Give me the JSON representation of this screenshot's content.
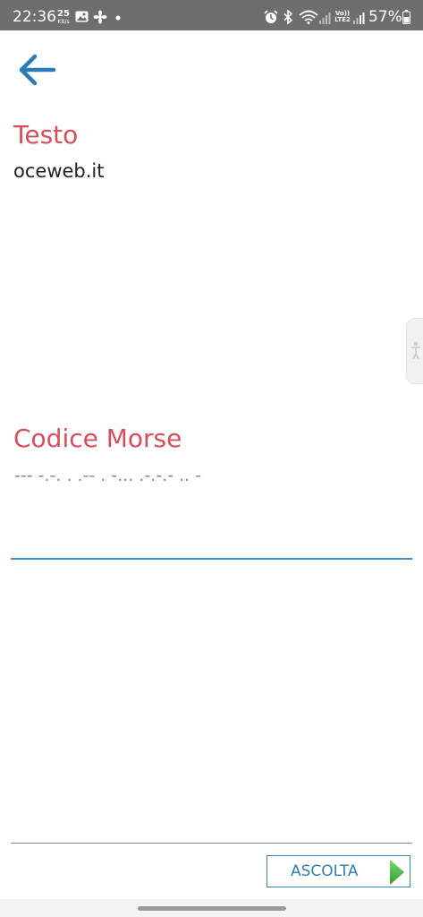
{
  "status_bar": {
    "time": "22:36",
    "net_speed_value": "25",
    "net_speed_unit": "KB/s",
    "battery_text": "57%",
    "volte_label": "Vo)) LTE2",
    "icons": [
      "gallery-icon",
      "fan-icon",
      "dot-icon",
      "alarm-icon",
      "bluetooth-icon",
      "wifi-icon",
      "signal-icon",
      "volte-icon",
      "signal-icon",
      "battery-icon"
    ]
  },
  "header": {
    "back_icon": "arrow-left-icon"
  },
  "text_section": {
    "label": "Testo",
    "value": "oceweb.it"
  },
  "morse_section": {
    "label": "Codice Morse",
    "value": "--- -.-. . .-- . -... .-.-.- .. -"
  },
  "footer": {
    "listen_label": "ASCOLTA",
    "play_icon": "play-icon"
  },
  "colors": {
    "label_red": "#d64f5b",
    "accent_blue": "#3f8fcf",
    "status_bar_bg": "#6e6e6e",
    "play_green": "#4db84a"
  }
}
